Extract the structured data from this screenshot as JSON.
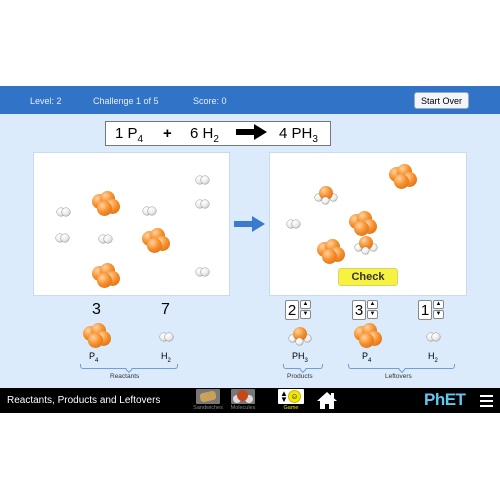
{
  "status_bar": {
    "level": "Level: 2",
    "challenge": "Challenge 1 of 5",
    "score": "Score: 0",
    "start_over_label": "Start Over"
  },
  "equation": {
    "reactant1_coef": "1",
    "reactant1_formula": "P",
    "reactant1_sub": "4",
    "plus": "+",
    "reactant2_coef": "6",
    "reactant2_formula": "H",
    "reactant2_sub": "2",
    "arrow": "➔",
    "product_coef": "4",
    "product_formula": "PH",
    "product_sub": "3"
  },
  "before_box": {
    "molecules": [
      {
        "type": "P4",
        "count": 3
      },
      {
        "type": "H2",
        "count": 7
      }
    ]
  },
  "after_box": {
    "molecules": [
      {
        "type": "PH3",
        "count": 2
      },
      {
        "type": "P4",
        "count": 3
      },
      {
        "type": "H2",
        "count": 1
      }
    ],
    "check_label": "Check"
  },
  "reactants": {
    "group_label": "Reactants",
    "items": [
      {
        "count": "3",
        "formula": "P",
        "sub": "4"
      },
      {
        "count": "7",
        "formula": "H",
        "sub": "2"
      }
    ]
  },
  "products": {
    "group_label": "Products",
    "items": [
      {
        "value": "2",
        "formula": "PH",
        "sub": "3"
      }
    ]
  },
  "leftovers": {
    "group_label": "Leftovers",
    "items": [
      {
        "value": "3",
        "formula": "P",
        "sub": "4"
      },
      {
        "value": "1",
        "formula": "H",
        "sub": "2"
      }
    ]
  },
  "spinner": {
    "up": "▲",
    "down": "▼"
  },
  "navbar": {
    "title": "Reactants, Products and Leftovers",
    "screens": [
      {
        "label": "Sandwiches",
        "icon": "sandwich-icon",
        "selected": false
      },
      {
        "label": "Molecules",
        "icon": "molecule-icon",
        "selected": false
      },
      {
        "label": "Game",
        "icon": "smiley-icon",
        "selected": true
      }
    ],
    "brand": "PhET",
    "colors": {
      "selected_label": "#f5e600",
      "brand": "#62c6ee"
    }
  }
}
